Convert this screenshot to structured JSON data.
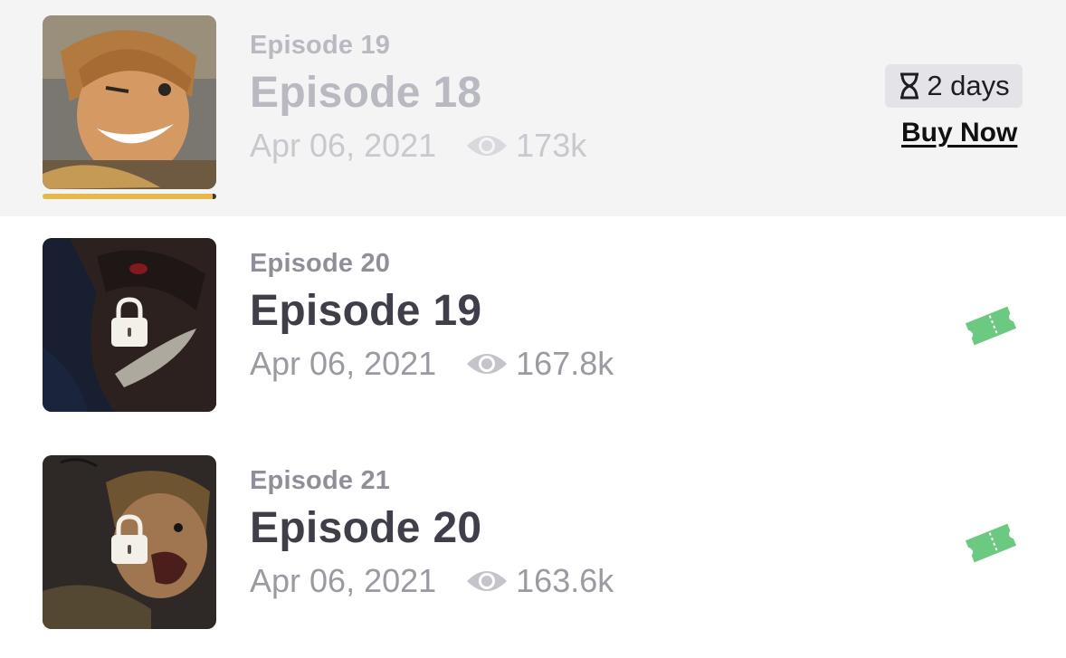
{
  "colors": {
    "read_bg": "#f4f4f5",
    "progress": "#e7b84c",
    "ticket": "#6cc982"
  },
  "episodes": [
    {
      "subtitle": "Episode 19",
      "title": "Episode 18",
      "date": "Apr 06, 2021",
      "views": "173k",
      "state": "read",
      "timer_icon": "hourglass-icon",
      "timer_label": "2 days",
      "action_label": "Buy Now"
    },
    {
      "subtitle": "Episode 20",
      "title": "Episode 19",
      "date": "Apr 06, 2021",
      "views": "167.8k",
      "state": "locked",
      "action_icon": "ticket-icon"
    },
    {
      "subtitle": "Episode 21",
      "title": "Episode 20",
      "date": "Apr 06, 2021",
      "views": "163.6k",
      "state": "locked",
      "action_icon": "ticket-icon"
    }
  ]
}
